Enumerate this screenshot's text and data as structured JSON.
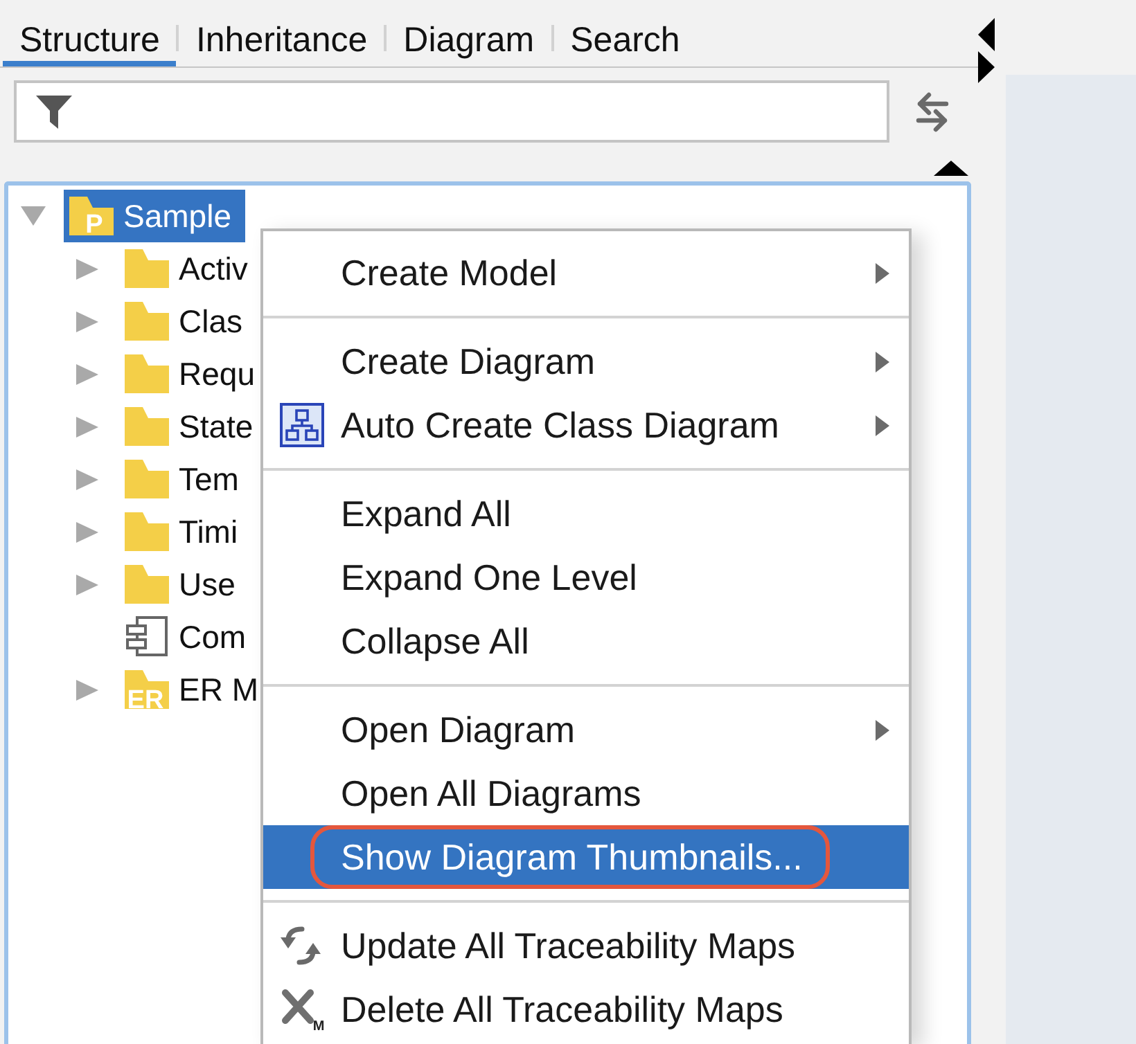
{
  "tabs": [
    {
      "label": "Structure",
      "selected": true
    },
    {
      "label": "Inheritance",
      "selected": false
    },
    {
      "label": "Diagram",
      "selected": false
    },
    {
      "label": "Search",
      "selected": false
    }
  ],
  "tree": {
    "nodes": [
      {
        "label": "Sample",
        "kind": "project",
        "icon_text": "P",
        "expanded": true,
        "selected": true,
        "children": [
          {
            "label": "Activ",
            "kind": "folder",
            "expanded": false,
            "selected": false
          },
          {
            "label": "Clas",
            "kind": "folder",
            "expanded": false,
            "selected": false
          },
          {
            "label": "Requ",
            "kind": "folder",
            "expanded": false,
            "selected": false
          },
          {
            "label": "State",
            "kind": "folder",
            "expanded": false,
            "selected": false
          },
          {
            "label": "Tem",
            "kind": "folder",
            "expanded": false,
            "selected": false
          },
          {
            "label": "Timi",
            "kind": "folder",
            "expanded": false,
            "selected": false
          },
          {
            "label": "Use",
            "kind": "folder",
            "expanded": false,
            "selected": false
          },
          {
            "label": "Com",
            "kind": "component",
            "selected": false
          },
          {
            "label": "ER M",
            "kind": "er-model",
            "icon_text": "ER",
            "expanded": false,
            "selected": false
          }
        ]
      }
    ]
  },
  "context_menu": {
    "items": [
      {
        "kind": "item",
        "label": "Create Model",
        "submenu": true,
        "selected": false,
        "circled": false
      },
      {
        "kind": "separator"
      },
      {
        "kind": "item",
        "label": "Create Diagram",
        "submenu": true,
        "selected": false,
        "circled": false
      },
      {
        "kind": "item",
        "label": "Auto Create Class Diagram",
        "submenu": true,
        "selected": false,
        "circled": false
      },
      {
        "kind": "separator"
      },
      {
        "kind": "item",
        "label": "Expand All",
        "submenu": false,
        "selected": false,
        "circled": false
      },
      {
        "kind": "item",
        "label": "Expand One Level",
        "submenu": false,
        "selected": false,
        "circled": false
      },
      {
        "kind": "item",
        "label": "Collapse All",
        "submenu": false,
        "selected": false,
        "circled": false
      },
      {
        "kind": "separator"
      },
      {
        "kind": "item",
        "label": "Open Diagram",
        "submenu": true,
        "selected": false,
        "circled": false
      },
      {
        "kind": "item",
        "label": "Open All Diagrams",
        "submenu": false,
        "selected": false,
        "circled": false
      },
      {
        "kind": "item",
        "label": "Show Diagram Thumbnails...",
        "submenu": false,
        "selected": true,
        "circled": true
      },
      {
        "kind": "separator"
      },
      {
        "kind": "item",
        "label": "Update All Traceability Maps",
        "submenu": false,
        "selected": false,
        "circled": false
      },
      {
        "kind": "item",
        "label": "Delete All Traceability Maps",
        "icon_text": "M",
        "submenu": false,
        "selected": false,
        "circled": false
      }
    ]
  }
}
